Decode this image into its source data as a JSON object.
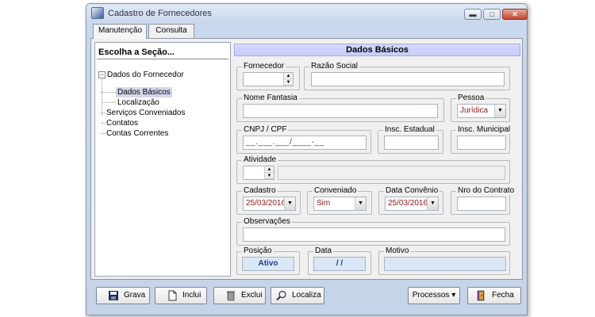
{
  "window": {
    "title": "Cadastro de Fornecedores",
    "min_glyph": "▬",
    "max_glyph": "□",
    "close_glyph": "✕"
  },
  "tabs": [
    {
      "label": "Manutenção"
    },
    {
      "label": "Consulta"
    }
  ],
  "tree": {
    "title": "Escolha a Seção...",
    "expander_glyph": "−",
    "items": [
      {
        "label": "Dados do Fornecedor"
      },
      {
        "label": "Dados Básicos"
      },
      {
        "label": "Localização"
      },
      {
        "label": "Serviços Conveniados"
      },
      {
        "label": "Contatos"
      },
      {
        "label": "Contas Correntes"
      }
    ]
  },
  "section": {
    "title": "Dados Básicos"
  },
  "form": {
    "fornecedor": {
      "label": "Fornecedor",
      "value": ""
    },
    "razao_social": {
      "label": "Razão Social",
      "value": ""
    },
    "nome_fantasia": {
      "label": "Nome Fantasia",
      "value": ""
    },
    "pessoa": {
      "label": "Pessoa",
      "value": "Jurídica"
    },
    "cnpj": {
      "label": "CNPJ / CPF",
      "mask": "__.___.___/____-__"
    },
    "insc_estadual": {
      "label": "Insc. Estadual",
      "value": ""
    },
    "insc_municipal": {
      "label": "Insc. Municipal",
      "value": ""
    },
    "atividade": {
      "label": "Atividade",
      "value": ""
    },
    "cadastro": {
      "label": "Cadastro",
      "value": "25/03/2016"
    },
    "conveniado": {
      "label": "Conveniado",
      "value": "Sim"
    },
    "data_convenio": {
      "label": "Data Convênio",
      "value": "25/03/2016"
    },
    "nro_contrato": {
      "label": "Nro do Contrato",
      "value": ""
    },
    "observacoes": {
      "label": "Observações",
      "value": ""
    },
    "posicao": {
      "label": "Posição",
      "value": "Ativo"
    },
    "data": {
      "label": "Data",
      "value": "/ /"
    },
    "motivo": {
      "label": "Motivo",
      "value": ""
    }
  },
  "buttons": {
    "grava": "Grava",
    "inclui": "Inclui",
    "exclui": "Exclui",
    "localiza": "Localiza",
    "processos": "Processos ▾",
    "fecha": "Fecha"
  },
  "icons": {
    "grava": "save-icon",
    "inclui": "new-document-icon",
    "exclui": "trash-icon",
    "localiza": "search-icon",
    "fecha": "exit-door-icon"
  },
  "colors": {
    "header_bg": "#c8ccf8",
    "selected_item_bg": "#d6d6ec",
    "value_text": "#8b1a1a",
    "status_text": "#1f3f8a"
  }
}
